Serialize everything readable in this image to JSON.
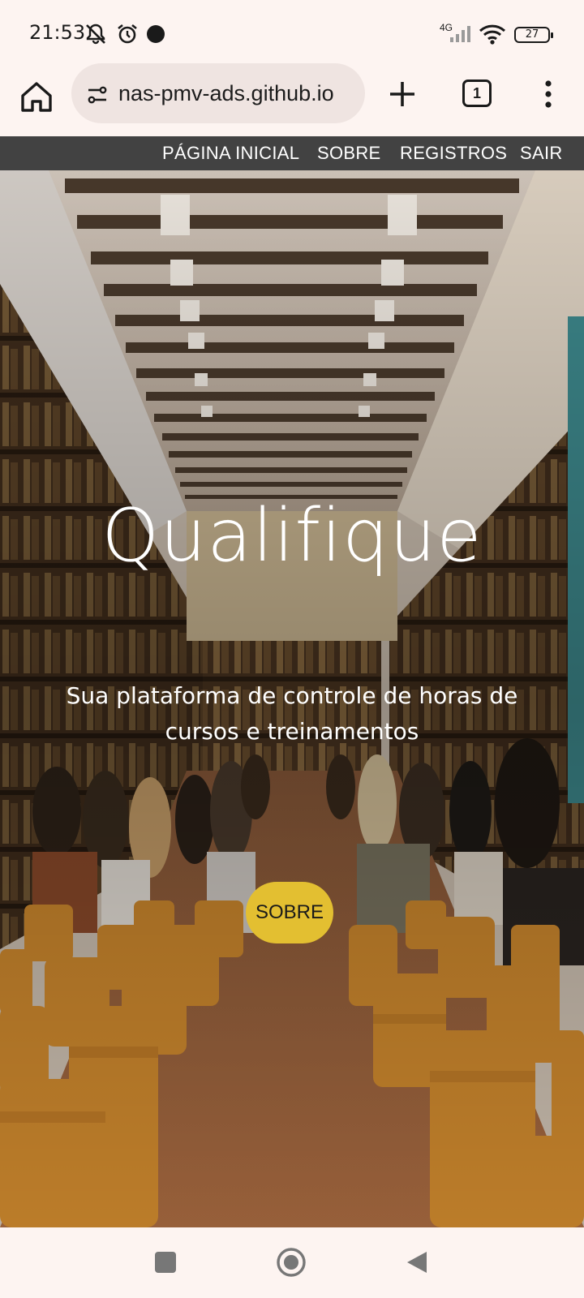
{
  "status_bar": {
    "time": "21:53",
    "network": "4G",
    "battery": "27",
    "icons": [
      "notifications-off-icon",
      "alarm-icon",
      "dot-icon",
      "signal-icon",
      "wifi-icon",
      "battery-icon"
    ]
  },
  "browser": {
    "url": "nas-pmv-ads.github.io",
    "tab_count": "1",
    "icons": [
      "home-icon",
      "site-settings-icon",
      "plus-icon",
      "tabs-icon",
      "more-vert-icon"
    ]
  },
  "site_nav": {
    "items": [
      {
        "label": "PÁGINA INICIAL"
      },
      {
        "label": "SOBRE"
      },
      {
        "label": "REGISTROS"
      },
      {
        "label": "SAIR"
      }
    ]
  },
  "hero": {
    "title": "Qualifique",
    "subtitle": "Sua plataforma de controle de horas de cursos e treinamentos",
    "button_label": "SOBRE",
    "accent_color": "#e3bf31"
  },
  "android_nav": {
    "icons": [
      "recents-icon",
      "home-circle-icon",
      "back-icon"
    ]
  }
}
